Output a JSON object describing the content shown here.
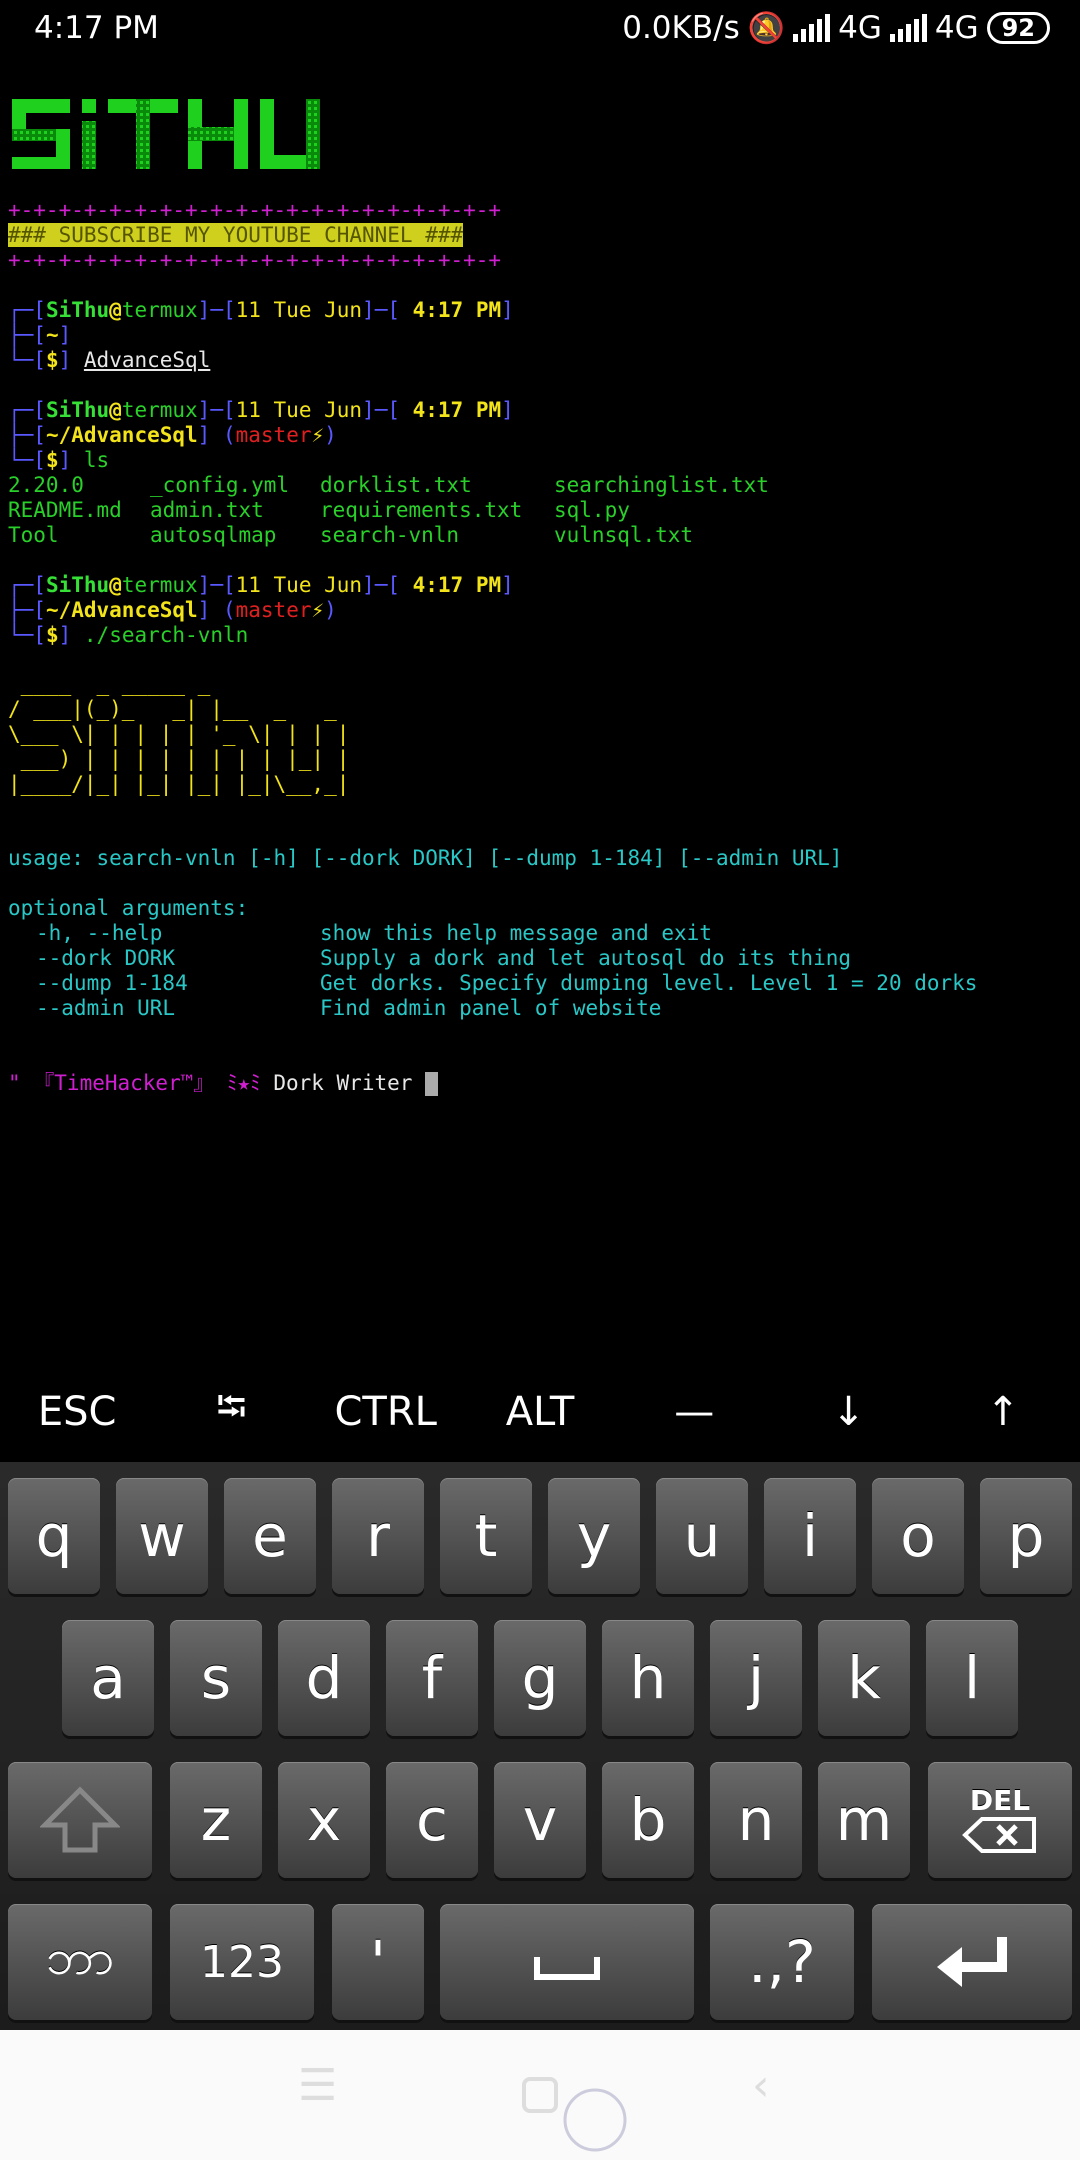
{
  "status_bar": {
    "time": "4:17 PM",
    "speed": "0.0KB/s",
    "net1": "4G",
    "net2": "4G",
    "battery": "92"
  },
  "logo_text": "SiTHU",
  "banner": {
    "border": "+-+-+-+-+-+-+-+-+-+-+-+-+-+-+-+-+-+-+-+",
    "text": "### SUBSCRIBE MY YOUTUBE CHANNEL ###"
  },
  "prompts": [
    {
      "user": "SiThu",
      "host": "termux",
      "date": "11 Tue Jun",
      "time": "4:17 PM",
      "dir": "~",
      "branch": "",
      "cmd": "AdvanceSql"
    },
    {
      "user": "SiThu",
      "host": "termux",
      "date": "11 Tue Jun",
      "time": "4:17 PM",
      "dir": "~/AdvanceSql",
      "branch": "master",
      "cmd": "ls"
    },
    {
      "user": "SiThu",
      "host": "termux",
      "date": "11 Tue Jun",
      "time": "4:17 PM",
      "dir": "~/AdvanceSql",
      "branch": "master",
      "cmd": "./search-vnln"
    }
  ],
  "ls_output": [
    [
      "2.20.0",
      "_config.yml",
      "dorklist.txt",
      "searchinglist.txt"
    ],
    [
      "README.md",
      "admin.txt",
      "requirements.txt",
      "sql.py"
    ],
    [
      "Tool",
      "autosqlmap",
      "search-vnln",
      "vulnsql.txt"
    ]
  ],
  "ascii_art": " ____  _ _____ _\n/ ___|(_)_   _| |__  _   _\n\\___ \\| | | | | '_ \\| | | |\n ___) | | | | | | | | |_| |\n|____/|_| |_| |_| |_|\\__,_|",
  "usage": "usage: search-vnln [-h] [--dork DORK] [--dump 1-184] [--admin URL]",
  "optional_header": "optional arguments:",
  "arguments": [
    {
      "flag": "-h, --help",
      "desc": "show this help message and exit"
    },
    {
      "flag": "--dork DORK",
      "desc": "Supply a dork and let autosql do its thing"
    },
    {
      "flag": "--dump 1-184",
      "desc": "Get dorks. Specify dumping level. Level 1 = 20 dorks"
    },
    {
      "flag": "--admin URL",
      "desc": "Find admin panel of website"
    }
  ],
  "final_prompt": {
    "prefix": "\" 『TimeHacker™』 ﾐ★ﾐ",
    "text": "Dork Writer"
  },
  "extra_keys": [
    "ESC",
    "⭾",
    "CTRL",
    "ALT",
    "—",
    "↓",
    "↑"
  ],
  "keyboard": {
    "row1": [
      "q",
      "w",
      "e",
      "r",
      "t",
      "y",
      "u",
      "i",
      "o",
      "p"
    ],
    "row2": [
      "a",
      "s",
      "d",
      "f",
      "g",
      "h",
      "j",
      "k",
      "l"
    ],
    "row3": [
      "z",
      "x",
      "c",
      "v",
      "b",
      "n",
      "m"
    ],
    "del_label": "DEL",
    "lang_label": "ဘာ",
    "num_label": "123",
    "apostrophe": "'",
    "punct_label": ".,?"
  },
  "colors": {
    "magenta": "#d01fd0",
    "green": "#2ad02a",
    "yellow": "#f2e31a",
    "cyan": "#2ac7c7",
    "blue": "#5a58ff",
    "red": "#e02020"
  }
}
